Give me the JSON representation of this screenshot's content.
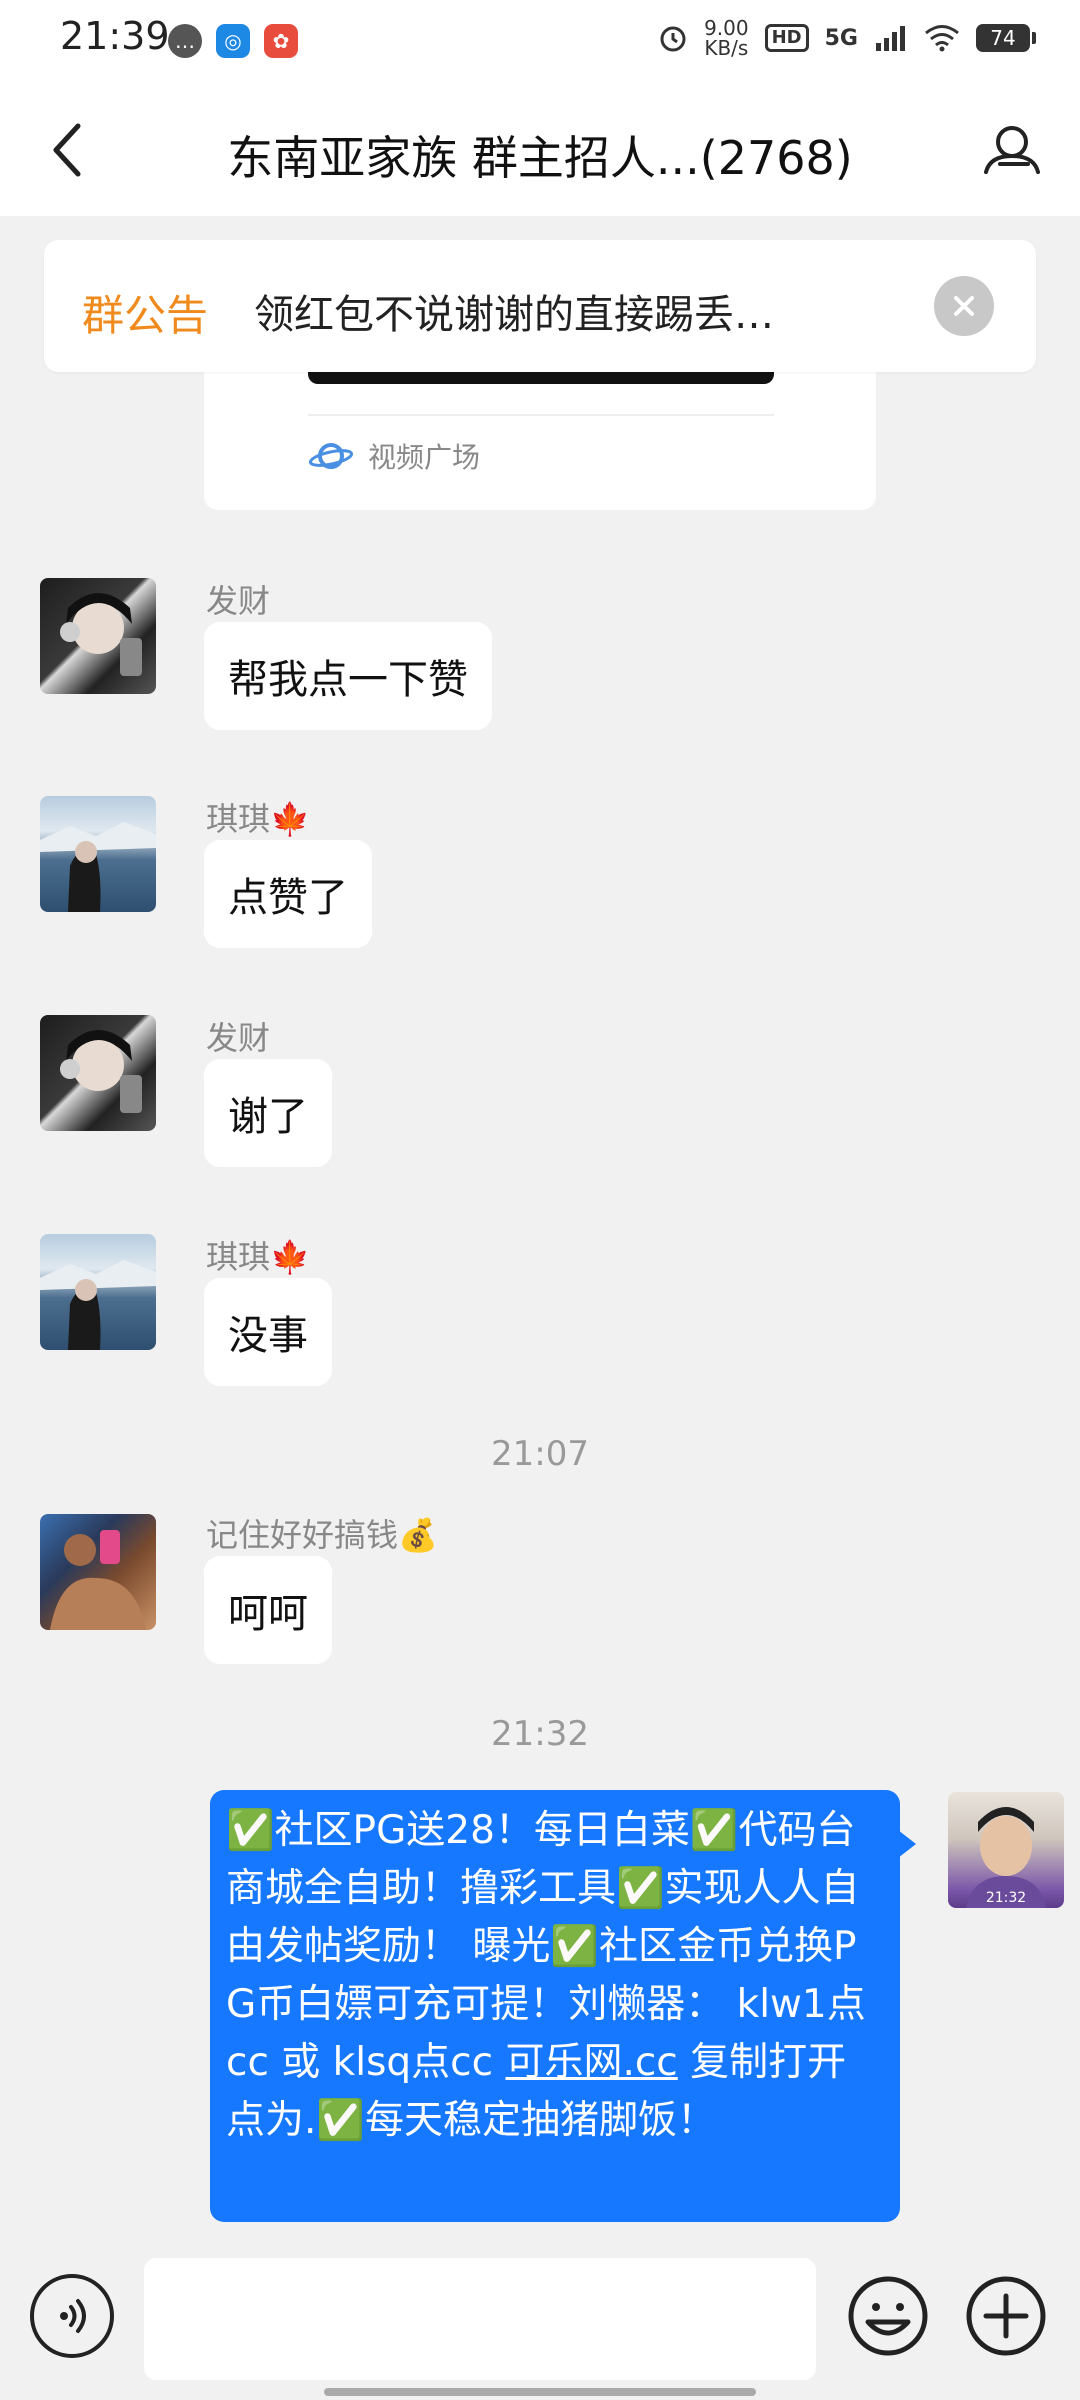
{
  "status_bar": {
    "time": "21:39",
    "net_speed_value": "9.00",
    "net_speed_unit": "KB/s",
    "hd_label": "HD",
    "network": "5G",
    "battery": "74"
  },
  "header": {
    "title": "东南亚家族 群主招人...(2768)"
  },
  "announcement": {
    "label": "群公告",
    "text": "领红包不说谢谢的直接踢丢…"
  },
  "video_card": {
    "source": "视频广场"
  },
  "messages": [
    {
      "sender": "发财",
      "text": "帮我点一下赞"
    },
    {
      "sender": "琪琪🍁",
      "text": "点赞了"
    },
    {
      "sender": "发财",
      "text": "谢了"
    },
    {
      "sender": "琪琪🍁",
      "text": "没事"
    },
    {
      "sender": "记住好好搞钱💰",
      "text": "呵呵"
    }
  ],
  "timestamps": [
    "21:07",
    "21:32"
  ],
  "own_message": {
    "text_before": "✅社区PG送28！每日白菜✅代码台商城全自助！撸彩工具✅实现人人自由发帖奖励！ 曝光✅社区金币兑换PG币白嫖可充可提！刘懒器： klw1点cc 或 klsq点cc ",
    "link": "可乐网.cc",
    "text_after": " 复制打开点为.✅每天稳定抽猪脚饭！",
    "avatar_time": "21:32"
  },
  "input": {
    "placeholder": ""
  },
  "colors": {
    "accent_blue": "#1677ff",
    "announce_orange": "#f08a1c",
    "background": "#f1f1f1"
  }
}
